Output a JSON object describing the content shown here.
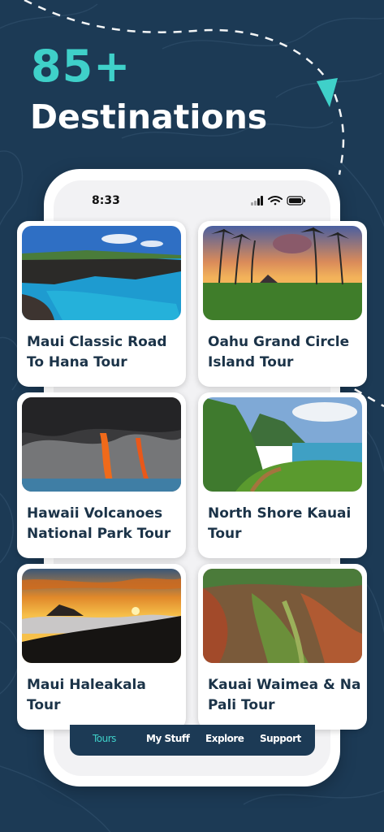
{
  "hero": {
    "count": "85+",
    "title": "Destinations"
  },
  "status_bar": {
    "time": "8:33"
  },
  "tours": [
    {
      "title": "Maui Classic Road To Hana Tour",
      "image": "ocean-lava-coast-photo"
    },
    {
      "title": "Oahu Grand Circle Island Tour",
      "image": "palm-sunset-photo"
    },
    {
      "title": "Hawaii Volcanoes National Park Tour",
      "image": "lava-flow-photo"
    },
    {
      "title": "North Shore Kauai Tour",
      "image": "green-cliffs-trail-photo"
    },
    {
      "title": "Maui Haleakala Tour",
      "image": "sunrise-above-clouds-photo"
    },
    {
      "title": "Kauai Waimea & Na Pali Tour",
      "image": "canyon-photo"
    }
  ],
  "tabs": [
    {
      "label": "Tours",
      "active": true
    },
    {
      "label": "My Stuff",
      "active": false
    },
    {
      "label": "Explore",
      "active": false
    },
    {
      "label": "Support",
      "active": false
    }
  ],
  "colors": {
    "background": "#1c3a55",
    "accent": "#3fd0c9",
    "title_text": "#1b3348"
  }
}
